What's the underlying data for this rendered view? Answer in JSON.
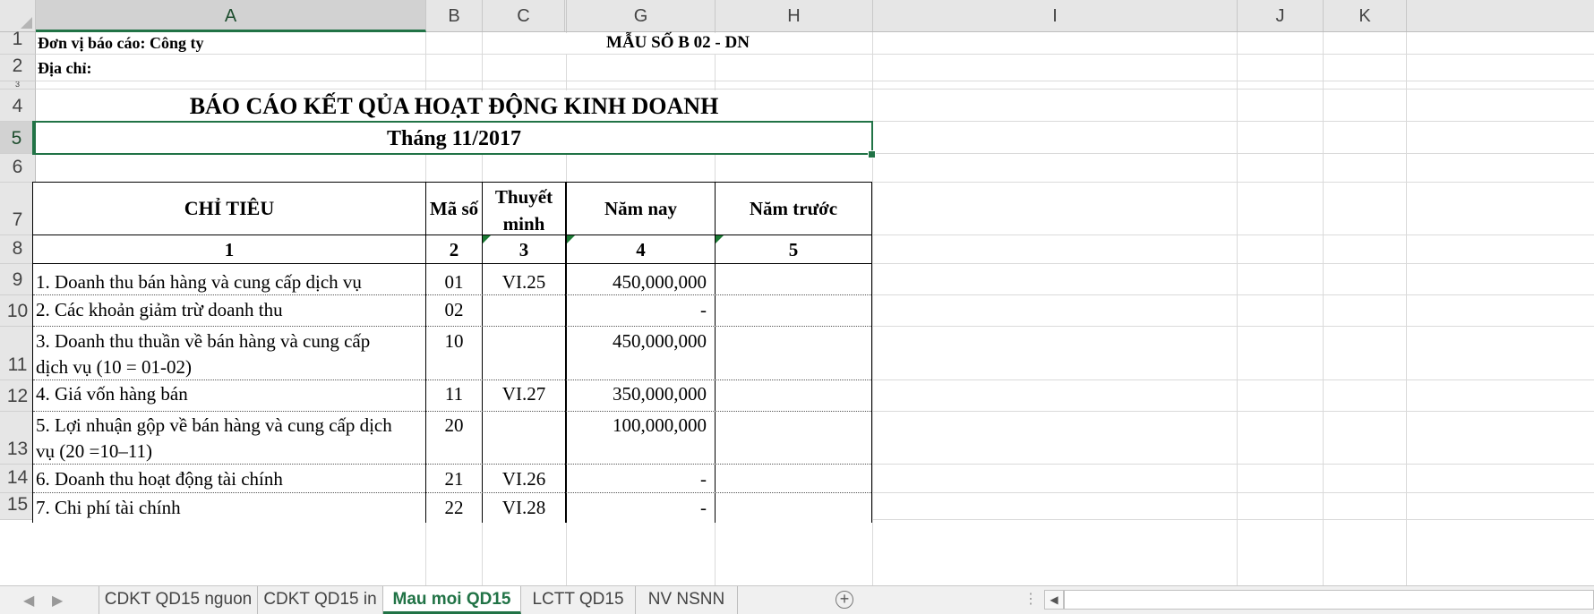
{
  "columns": [
    {
      "key": "A",
      "label": "A"
    },
    {
      "key": "B",
      "label": "B"
    },
    {
      "key": "C",
      "label": "C"
    },
    {
      "key": "G",
      "label": "G"
    },
    {
      "key": "H",
      "label": "H"
    },
    {
      "key": "I",
      "label": "I"
    },
    {
      "key": "J",
      "label": "J"
    },
    {
      "key": "K",
      "label": "K"
    }
  ],
  "rows": [
    "1",
    "2",
    "3",
    "4",
    "5",
    "6",
    "7",
    "8",
    "9",
    "10",
    "11",
    "12",
    "13",
    "14",
    "15"
  ],
  "header": {
    "unit": "Đơn vị báo cáo: Công ty",
    "form_code": "MẪU SỐ B 02 - DN",
    "address": "Địa chỉ:",
    "title": "BÁO CÁO KẾT QỦA HOẠT ĐỘNG KINH DOANH",
    "period": "Tháng 11/2017"
  },
  "table": {
    "headers": {
      "col1": "CHỈ TIÊU",
      "col2": "Mã số",
      "col3_line1": "Thuyết",
      "col3_line2": "minh",
      "col4": "Năm nay",
      "col5": "Năm trước"
    },
    "numbers": {
      "n1": "1",
      "n2": "2",
      "n3": "3",
      "n4": "4",
      "n5": "5"
    },
    "rows": [
      {
        "line1": "1. Doanh thu bán hàng và cung cấp dịch vụ",
        "line2": "",
        "code": "01",
        "note": "VI.25",
        "current": "450,000,000",
        "previous": ""
      },
      {
        "line1": "2. Các khoản giảm trừ doanh thu",
        "line2": "",
        "code": "02",
        "note": "",
        "current": "-",
        "previous": ""
      },
      {
        "line1": "3. Doanh thu thuần về bán hàng và cung  cấp",
        "line2": "dịch vụ (10 = 01-02)",
        "code": "10",
        "note": "",
        "current": "450,000,000",
        "previous": ""
      },
      {
        "line1": "4. Giá vốn hàng bán",
        "line2": "",
        "code": "11",
        "note": "VI.27",
        "current": "350,000,000",
        "previous": ""
      },
      {
        "line1": "5. Lợi nhuận gộp về bán hàng và cung cấp dịch",
        "line2": "vụ (20 =10–11)",
        "code": "20",
        "note": "",
        "current": "100,000,000",
        "previous": ""
      },
      {
        "line1": "6. Doanh thu hoạt động tài chính",
        "line2": "",
        "code": "21",
        "note": "VI.26",
        "current": "-",
        "previous": ""
      },
      {
        "line1": "7. Chi phí tài chính",
        "line2": "",
        "code": "22",
        "note": "VI.28",
        "current": "-",
        "previous": ""
      }
    ]
  },
  "tabs": [
    {
      "label": "CDKT QD15 nguon",
      "active": false
    },
    {
      "label": "CDKT QD15 in",
      "active": false
    },
    {
      "label": "Mau moi QD15",
      "active": true
    },
    {
      "label": "LCTT QD15",
      "active": false
    },
    {
      "label": "NV NSNN",
      "active": false
    }
  ],
  "icons": {
    "tab_prev": "tab-prev-arrow-icon",
    "tab_next": "tab-next-arrow-icon",
    "add_sheet": "plus-circle-icon",
    "scroll_left": "scroll-left-arrow-icon"
  },
  "colors": {
    "accent": "#217346",
    "header_bg": "#e6e6e6",
    "tabbar_bg": "#f0f0f0"
  }
}
